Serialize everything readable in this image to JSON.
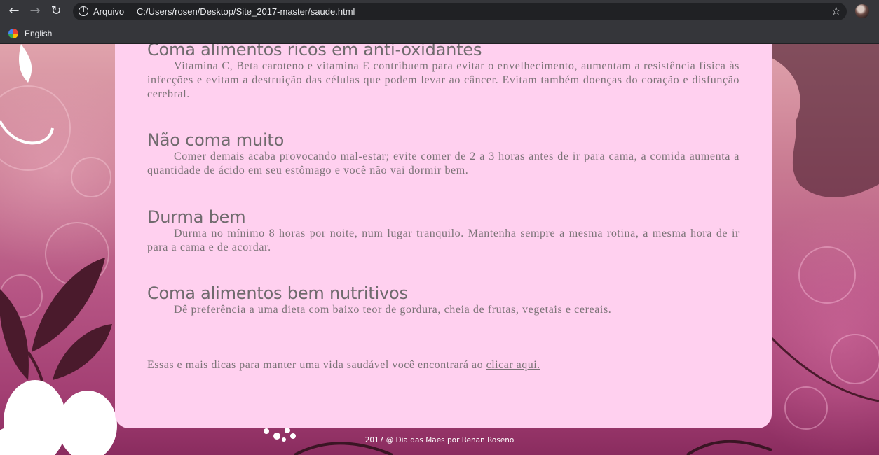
{
  "browser": {
    "back_icon": "←",
    "forward_icon": "→",
    "reload_icon": "↻",
    "site_label": "Arquivo",
    "url": "C:/Users/rosen/Desktop/Site_2017-master/saude.html",
    "star_icon": "☆"
  },
  "bookmarks": [
    {
      "label": "English"
    }
  ],
  "tips": [
    {
      "title": "Coma alimentos ricos em anti-oxidantes",
      "text": "Vitamina C, Beta caroteno e vitamina E contribuem para evitar o envelhecimento, aumentam a resistência física às infecções e evitam a destruição das células que podem levar ao câncer. Evitam também doenças do coração e disfunção cerebral."
    },
    {
      "title": "Não coma muito",
      "text": "Comer demais acaba provocando mal-estar; evite comer de 2 a 3 horas antes de ir para cama, a comida aumenta a quantidade de ácido em seu estômago e você não vai dormir bem."
    },
    {
      "title": "Durma bem",
      "text": "Durma no mínimo 8 horas por noite, num lugar tranquilo. Mantenha sempre a mesma rotina, a mesma hora de ir para a cama e de acordar."
    },
    {
      "title": "Coma alimentos bem nutritivos",
      "text": "Dê preferência a uma dieta com baixo teor de gordura, cheia de frutas, vegetais e cereais."
    }
  ],
  "closing": {
    "text": "Essas e mais dicas para manter uma vida saudável você encontrará ao ",
    "link_label": "clicar aqui."
  },
  "footer": {
    "text": "2017 @ Dia das Mães por Renan Roseno"
  }
}
